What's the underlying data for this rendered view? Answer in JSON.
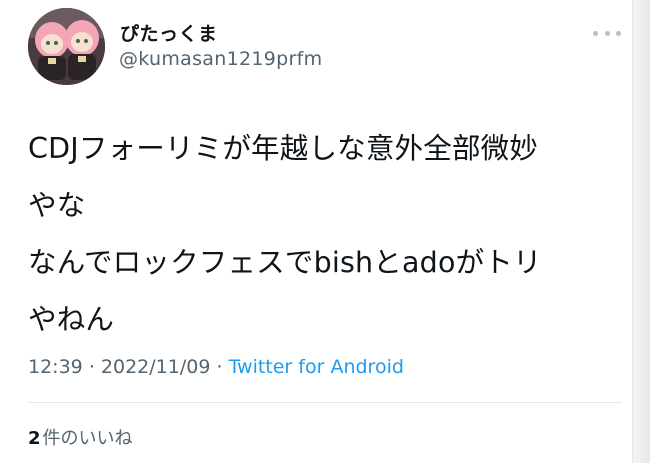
{
  "user": {
    "display_name": "ぴたっくま",
    "handle": "@kumasan1219prfm",
    "avatar_icon": "profile-photo-two-dolls"
  },
  "tweet": {
    "lines": [
      "CDJフォーリミが年越しな意外全部微妙",
      "やな",
      "なんでロックフェスでbishとadoがトリ",
      "やねん"
    ]
  },
  "meta": {
    "time": "12:39",
    "separator": "·",
    "date": "2022/11/09",
    "source": "Twitter for Android"
  },
  "engagement": {
    "likes_count": "2",
    "likes_label": "件のいいね"
  },
  "colors": {
    "text": "#0f1419",
    "secondary": "#536471",
    "link": "#1d9bf0",
    "divider": "#e4e8eb"
  }
}
